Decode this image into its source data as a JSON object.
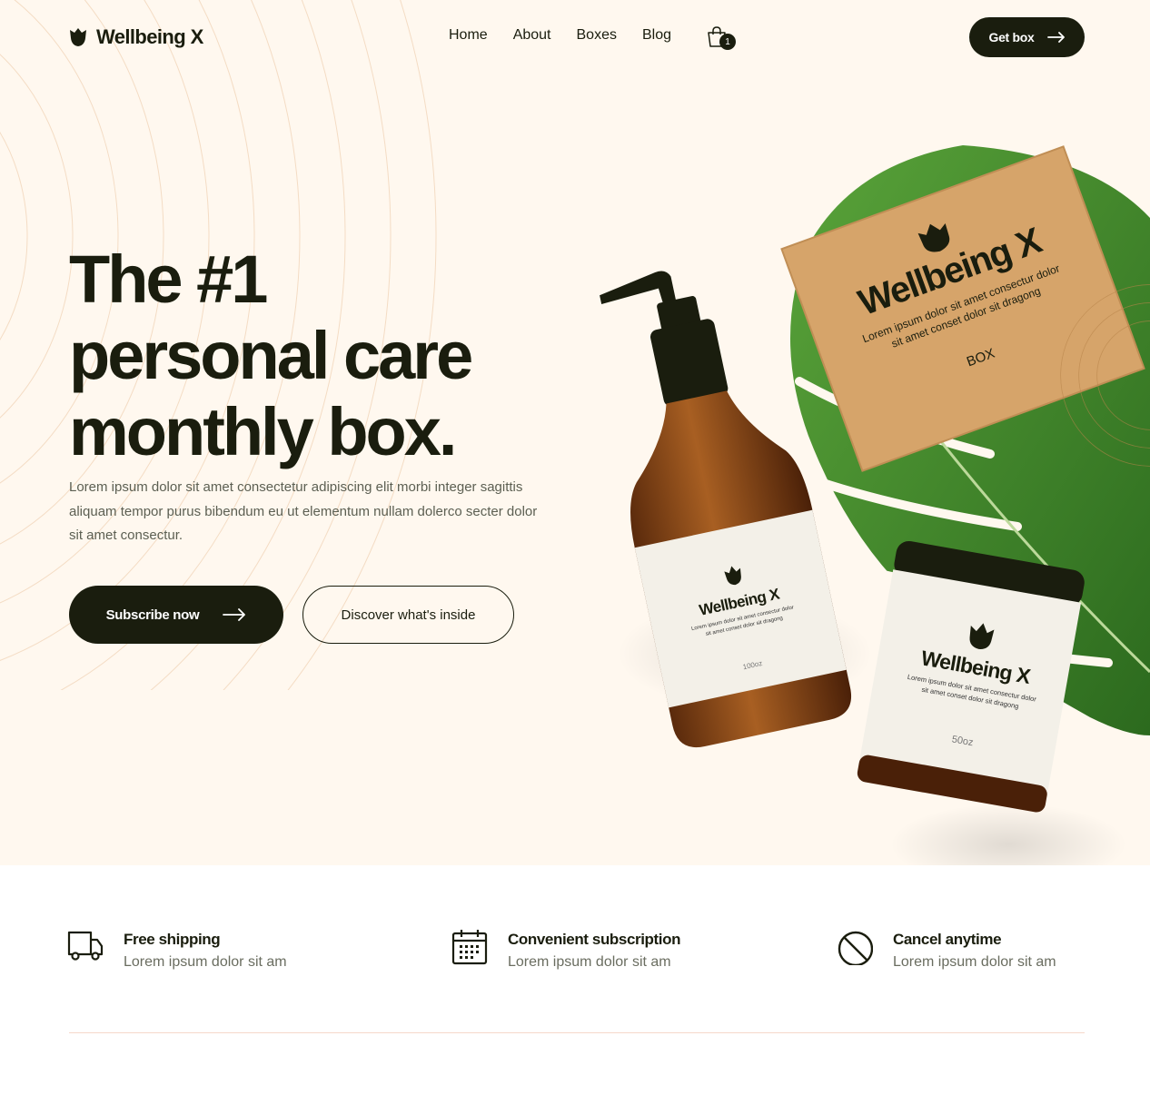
{
  "brand": {
    "name": "Wellbeing X",
    "colors": {
      "dark": "#1a1d0e",
      "cream": "#fff8ef",
      "kraft": "#d6a46a",
      "leaf": "#3e7e2a",
      "amber": "#8a4a1a"
    }
  },
  "nav": {
    "links": [
      "Home",
      "About",
      "Boxes",
      "Blog"
    ],
    "cart": {
      "icon": "shopping-bag-icon",
      "count": "1"
    },
    "cta": "Get box"
  },
  "hero": {
    "headline": [
      "The #1",
      "personal care",
      "monthly box."
    ],
    "lede": "Lorem ipsum dolor sit amet consectetur adipiscing elit morbi integer sagittis aliquam tempor purus bibendum eu ut elementum nullam dolerco secter dolor sit amet consectur.",
    "primary_cta": "Subscribe now",
    "secondary_cta": "Discover what's inside"
  },
  "products": {
    "box": {
      "brand": "Wellbeing X",
      "text1": "Lorem ipsum dolor sit amet consectur dolor",
      "text2": "sit amet conset dolor sit dragong",
      "label": "BOX"
    },
    "bottle": {
      "brand": "Wellbeing X",
      "text1": "Lorem ipsum dolor sit amet consectur dolor",
      "text2": "sit amet conset dolor sit dragong",
      "size": "100oz"
    },
    "jar": {
      "brand": "Wellbeing X",
      "text1": "Lorem ipsum dolor sit amet consectur dolor",
      "text2": "sit amet conset dolor sit dragong",
      "size": "50oz"
    }
  },
  "features": [
    {
      "icon": "truck-icon",
      "title": "Free shipping",
      "subtitle": "Lorem ipsum dolor sit am"
    },
    {
      "icon": "calendar-icon",
      "title": "Convenient subscription",
      "subtitle": "Lorem ipsum dolor sit am"
    },
    {
      "icon": "cancel-icon",
      "title": "Cancel anytime",
      "subtitle": "Lorem ipsum dolor sit am"
    }
  ]
}
